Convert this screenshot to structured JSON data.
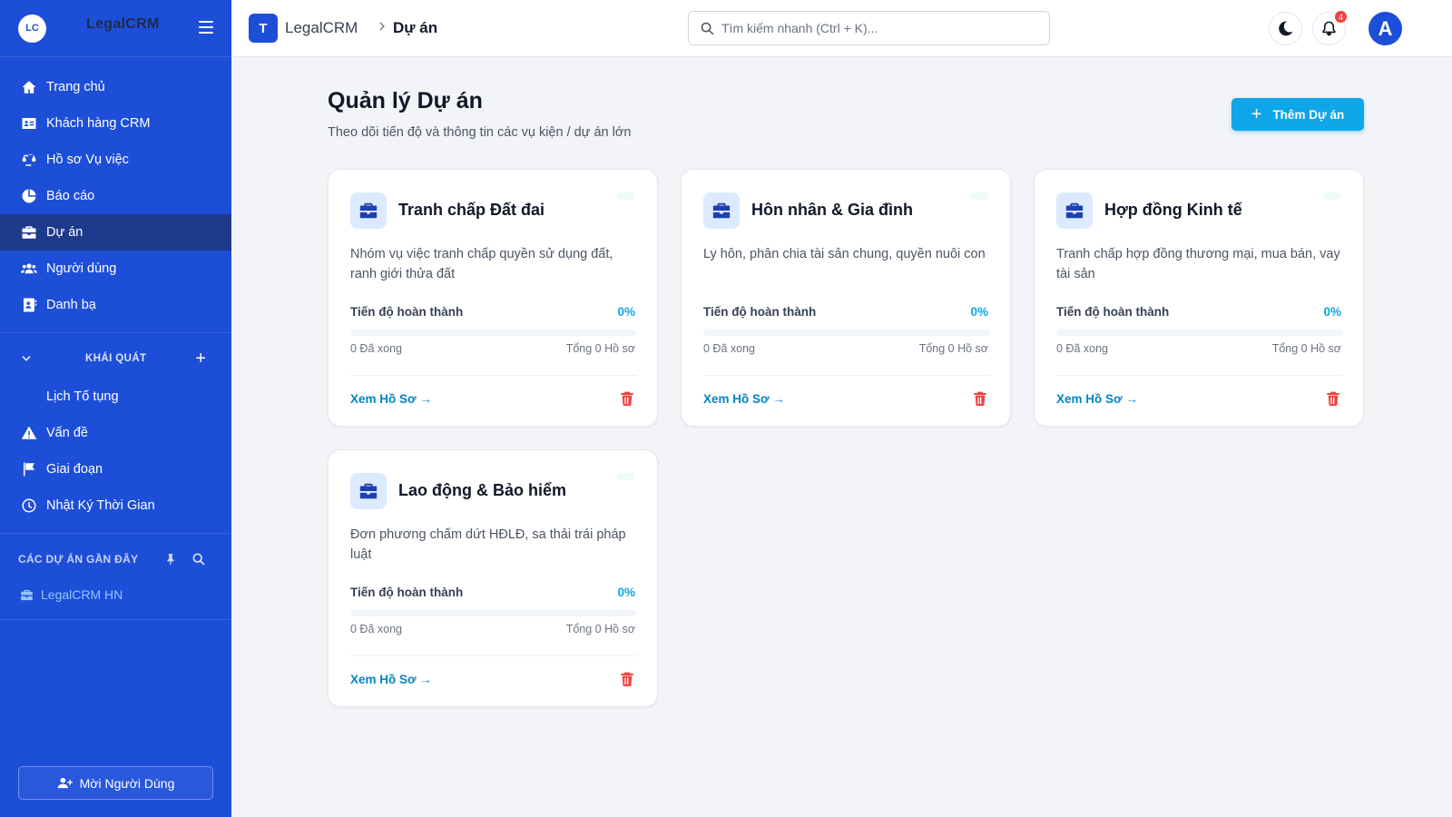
{
  "sidebar": {
    "logo_initials": "LC",
    "brand": "LegalCRM",
    "nav": [
      {
        "label": "Trang chủ",
        "icon": "home-icon"
      },
      {
        "label": "Khách hàng CRM",
        "icon": "id-card-icon"
      },
      {
        "label": "Hồ sơ Vụ việc",
        "icon": "scale-icon"
      },
      {
        "label": "Báo cáo",
        "icon": "pie-chart-icon"
      },
      {
        "label": "Dự án",
        "icon": "briefcase-icon",
        "active": true
      },
      {
        "label": "Người dùng",
        "icon": "users-icon"
      },
      {
        "label": "Danh bạ",
        "icon": "address-book-icon"
      }
    ],
    "section": {
      "title": "KHÁI QUÁT",
      "items": [
        {
          "label": "Lịch Tố tụng",
          "icon": ""
        },
        {
          "label": "Vấn đề",
          "icon": "warning-icon"
        },
        {
          "label": "Giai đoạn",
          "icon": "flag-icon"
        },
        {
          "label": "Nhật Ký Thời Gian",
          "icon": "clock-icon"
        }
      ]
    },
    "recent": {
      "title": "CÁC DỰ ÁN GẦN ĐÂY",
      "items": [
        {
          "label": "LegalCRM HN",
          "icon": "briefcase-icon"
        }
      ]
    },
    "invite_label": "Mời Người Dùng"
  },
  "topbar": {
    "logo_letter": "T",
    "app": "LegalCRM",
    "page": "Dự án",
    "search_placeholder": "Tìm kiếm nhanh (Ctrl + K)...",
    "notification_count": "4",
    "avatar_letter": "A"
  },
  "main": {
    "title": "Quản lý Dự án",
    "subtitle": "Theo dõi tiến độ và thông tin các vụ kiện / dự án lớn",
    "add_label": "Thêm Dự án",
    "progress_label": "Tiến độ hoàn thành",
    "view_label": "Xem Hồ Sơ →",
    "projects": [
      {
        "title": "Tranh chấp Đất đai",
        "desc": "Nhóm vụ việc tranh chấp quyền sử dụng đất, ranh giới thửa đất",
        "progress": "0%",
        "progress_fraction": 0,
        "done": "0 Đã xong",
        "total": "Tổng 0 Hồ sơ"
      },
      {
        "title": "Hôn nhân & Gia đình",
        "desc": "Ly hôn, phân chia tài sản chung, quyền nuôi con",
        "progress": "0%",
        "progress_fraction": 0,
        "done": "0 Đã xong",
        "total": "Tổng 0 Hồ sơ"
      },
      {
        "title": "Hợp đồng Kinh tế",
        "desc": "Tranh chấp hợp đồng thương mại, mua bán, vay tài sản",
        "progress": "0%",
        "progress_fraction": 0,
        "done": "0 Đã xong",
        "total": "Tổng 0 Hồ sơ"
      },
      {
        "title": "Lao động & Bảo hiểm",
        "desc": "Đơn phương chấm dứt HĐLĐ, sa thải trái pháp luật",
        "progress": "0%",
        "progress_fraction": 0,
        "done": "0 Đã xong",
        "total": "Tổng 0 Hồ sơ"
      }
    ]
  },
  "colors": {
    "sidebar": "#1d4ed8",
    "sidebar_active": "#1e3a8a",
    "accent": "#0ea5e9",
    "danger": "#ef4444"
  }
}
